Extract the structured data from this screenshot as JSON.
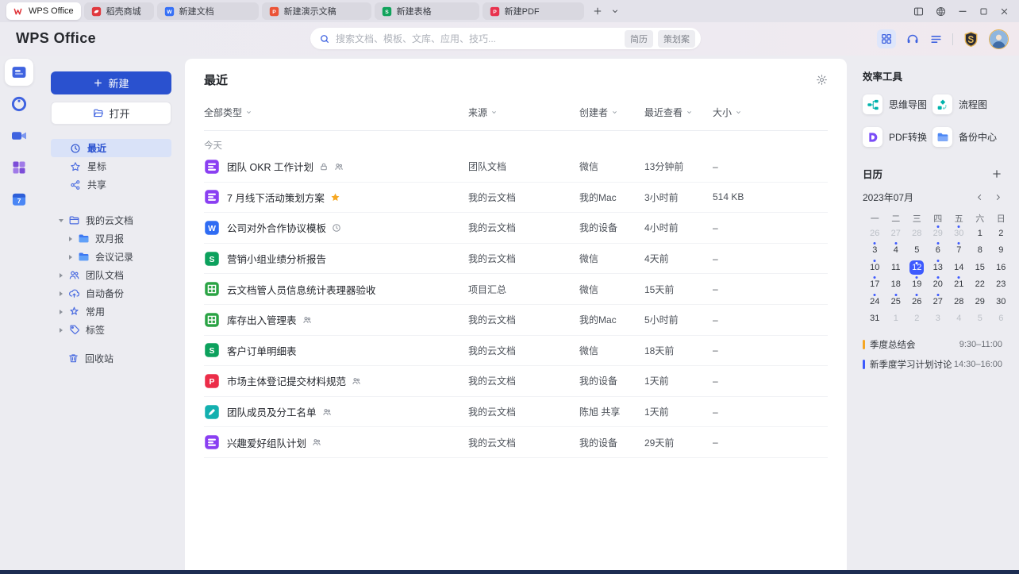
{
  "tabbar": {
    "tabs": [
      {
        "name": "tab-wps-office",
        "icon": "wps-logo-icon",
        "label": "WPS Office",
        "active": true
      },
      {
        "name": "tab-docer-mall",
        "icon": "docer-icon",
        "label": "稻壳商城",
        "active": false
      },
      {
        "name": "tab-new-doc",
        "icon": "doc-icon",
        "label": "新建文档",
        "active": false
      },
      {
        "name": "tab-new-presentation",
        "icon": "ppt-icon",
        "label": "新建演示文稿",
        "active": false
      },
      {
        "name": "tab-new-sheet",
        "icon": "sheet-icon",
        "label": "新建表格",
        "active": false
      },
      {
        "name": "tab-new-pdf",
        "icon": "pdf-icon",
        "label": "新建PDF",
        "active": false
      }
    ]
  },
  "header": {
    "logo": "WPS Office",
    "search": {
      "placeholder": "搜索文档、模板、文库、应用、技巧...",
      "tags": [
        "简历",
        "策划案"
      ]
    }
  },
  "rail": [
    {
      "name": "rail-home-docs",
      "icon": "home-docs-icon",
      "active": true
    },
    {
      "name": "rail-docer",
      "icon": "docer-disc-icon",
      "active": false
    },
    {
      "name": "rail-meeting",
      "icon": "meeting-icon",
      "active": false
    },
    {
      "name": "rail-apps",
      "icon": "apps-grid-purple-icon",
      "active": false
    },
    {
      "name": "rail-calendar",
      "icon": "calendar-7-icon",
      "active": false
    }
  ],
  "sidebar": {
    "new_button": "新建",
    "open_button": "打开",
    "nav": [
      {
        "name": "sidebar-item-recent",
        "icon": "clock-icon",
        "label": "最近",
        "active": true
      },
      {
        "name": "sidebar-item-starred",
        "icon": "star-icon",
        "label": "星标",
        "active": false
      },
      {
        "name": "sidebar-item-shared",
        "icon": "share-icon",
        "label": "共享",
        "active": false
      }
    ],
    "tree": [
      {
        "name": "sidebar-item-my-cloud-docs",
        "icon": "cloud-folder-icon",
        "label": "我的云文档",
        "arrow": "down",
        "level": 0
      },
      {
        "name": "sidebar-item-bimonthly-report",
        "icon": "folder-icon",
        "label": "双月报",
        "arrow": "right",
        "level": 1
      },
      {
        "name": "sidebar-item-meeting-notes",
        "icon": "folder-icon",
        "label": "会议记录",
        "arrow": "right",
        "level": 1
      },
      {
        "name": "sidebar-item-team-docs",
        "icon": "team-icon",
        "label": "团队文档",
        "arrow": "right",
        "level": 0
      },
      {
        "name": "sidebar-item-auto-backup",
        "icon": "cloud-backup-icon",
        "label": "自动备份",
        "arrow": "right",
        "level": 0
      },
      {
        "name": "sidebar-item-frequent",
        "icon": "frequent-icon",
        "label": "常用",
        "arrow": "right",
        "level": 0
      },
      {
        "name": "sidebar-item-tags",
        "icon": "tag-icon",
        "label": "标签",
        "arrow": "right",
        "level": 0
      }
    ],
    "trash": {
      "label": "回收站"
    }
  },
  "main": {
    "title": "最近",
    "filters": [
      {
        "name": "filter-all-types",
        "label": "全部类型"
      },
      {
        "name": "filter-source",
        "label": "来源"
      },
      {
        "name": "filter-creator",
        "label": "创建者"
      },
      {
        "name": "filter-recent-viewed",
        "label": "最近查看"
      },
      {
        "name": "filter-size",
        "label": "大小"
      }
    ],
    "section_label": "今天",
    "rows": [
      {
        "icon": "wpsdoc-file-icon",
        "title": "团队 OKR 工作计划",
        "badges": [
          "lock-icon",
          "members-icon"
        ],
        "source": "团队文档",
        "creator": "微信",
        "viewed": "13分钟前",
        "size": "–"
      },
      {
        "icon": "wpsdoc-file-icon",
        "title": "7 月线下活动策划方案",
        "badges": [
          "star-filled-icon"
        ],
        "source": "我的云文档",
        "creator": "我的Mac",
        "viewed": "3小时前",
        "size": "514 KB"
      },
      {
        "icon": "word-file-icon",
        "title": "公司对外合作协议模板",
        "badges": [
          "status-icon"
        ],
        "source": "我的云文档",
        "creator": "我的设备",
        "viewed": "4小时前",
        "size": "–"
      },
      {
        "icon": "sheet-file-icon",
        "title": "营销小组业绩分析报告",
        "badges": [],
        "source": "我的云文档",
        "creator": "微信",
        "viewed": "4天前",
        "size": "–"
      },
      {
        "icon": "smartsheet-file-icon",
        "title": "云文档管人员信息统计表理器验收",
        "badges": [],
        "source": "项目汇总",
        "creator": "微信",
        "viewed": "15天前",
        "size": "–"
      },
      {
        "icon": "smartsheet-file-icon",
        "title": "库存出入管理表",
        "badges": [
          "members-icon"
        ],
        "source": "我的云文档",
        "creator": "我的Mac",
        "viewed": "5小时前",
        "size": "–"
      },
      {
        "icon": "sheet-file-icon",
        "title": "客户订单明细表",
        "badges": [],
        "source": "我的云文档",
        "creator": "微信",
        "viewed": "18天前",
        "size": "–"
      },
      {
        "icon": "pdf-file-icon",
        "title": "市场主体登记提交材料规范",
        "badges": [
          "members-icon"
        ],
        "source": "我的云文档",
        "creator": "我的设备",
        "viewed": "1天前",
        "size": "–"
      },
      {
        "icon": "teamdoc-file-icon",
        "title": "团队成员及分工名单",
        "badges": [
          "members-icon"
        ],
        "source": "我的云文档",
        "creator": "陈旭 共享",
        "viewed": "1天前",
        "size": "–"
      },
      {
        "icon": "wpsdoc-file-icon",
        "title": "兴趣爱好组队计划",
        "badges": [
          "members-icon"
        ],
        "source": "我的云文档",
        "creator": "我的设备",
        "viewed": "29天前",
        "size": "–"
      }
    ]
  },
  "right_panel": {
    "tools_title": "效率工具",
    "tools": [
      {
        "name": "tool-mindmap",
        "icon": "mindmap-icon",
        "label": "思维导图"
      },
      {
        "name": "tool-flowchart",
        "icon": "flowchart-icon",
        "label": "流程图"
      },
      {
        "name": "tool-pdf-convert",
        "icon": "pdf-convert-icon",
        "label": "PDF转换"
      },
      {
        "name": "tool-backup-center",
        "icon": "backup-center-icon",
        "label": "备份中心"
      }
    ],
    "calendar": {
      "title": "日历",
      "month": "2023年07月",
      "weekdays": [
        "一",
        "二",
        "三",
        "四",
        "五",
        "六",
        "日"
      ],
      "days": [
        {
          "d": "26",
          "muted": true
        },
        {
          "d": "27",
          "muted": true
        },
        {
          "d": "28",
          "muted": true
        },
        {
          "d": "29",
          "muted": true,
          "dot": true
        },
        {
          "d": "30",
          "muted": true,
          "dot": true
        },
        {
          "d": "1"
        },
        {
          "d": "2"
        },
        {
          "d": "3",
          "dot": true
        },
        {
          "d": "4",
          "dot": true
        },
        {
          "d": "5"
        },
        {
          "d": "6",
          "dot": true
        },
        {
          "d": "7",
          "dot": true
        },
        {
          "d": "8"
        },
        {
          "d": "9"
        },
        {
          "d": "10",
          "dot": true
        },
        {
          "d": "11"
        },
        {
          "d": "12",
          "dot": true,
          "selected": true
        },
        {
          "d": "13",
          "dot": true
        },
        {
          "d": "14"
        },
        {
          "d": "15"
        },
        {
          "d": "16"
        },
        {
          "d": "17",
          "dot": true
        },
        {
          "d": "18"
        },
        {
          "d": "19",
          "dot": true
        },
        {
          "d": "20",
          "dot": true
        },
        {
          "d": "21",
          "dot": true
        },
        {
          "d": "22"
        },
        {
          "d": "23"
        },
        {
          "d": "24",
          "dot": true
        },
        {
          "d": "25",
          "dot": true
        },
        {
          "d": "26",
          "dot": true
        },
        {
          "d": "27",
          "dot": true
        },
        {
          "d": "28"
        },
        {
          "d": "29"
        },
        {
          "d": "30"
        },
        {
          "d": "31"
        },
        {
          "d": "1",
          "muted": true
        },
        {
          "d": "2",
          "muted": true
        },
        {
          "d": "3",
          "muted": true
        },
        {
          "d": "4",
          "muted": true
        },
        {
          "d": "5",
          "muted": true
        },
        {
          "d": "6",
          "muted": true
        }
      ],
      "events": [
        {
          "name": "event-quarterly-summary",
          "color": "#f5a623",
          "label": "季度总结会",
          "time": "9:30–11:00"
        },
        {
          "name": "event-study-plan-discussion",
          "color": "#3d5afe",
          "label": "新季度学习计划讨论",
          "time": "14:30–16:00"
        }
      ]
    }
  },
  "colors": {
    "accent": "#2a51cf",
    "calendar_selected": "#3d5afe",
    "event_orange": "#f5a623",
    "event_blue": "#3d5afe"
  }
}
